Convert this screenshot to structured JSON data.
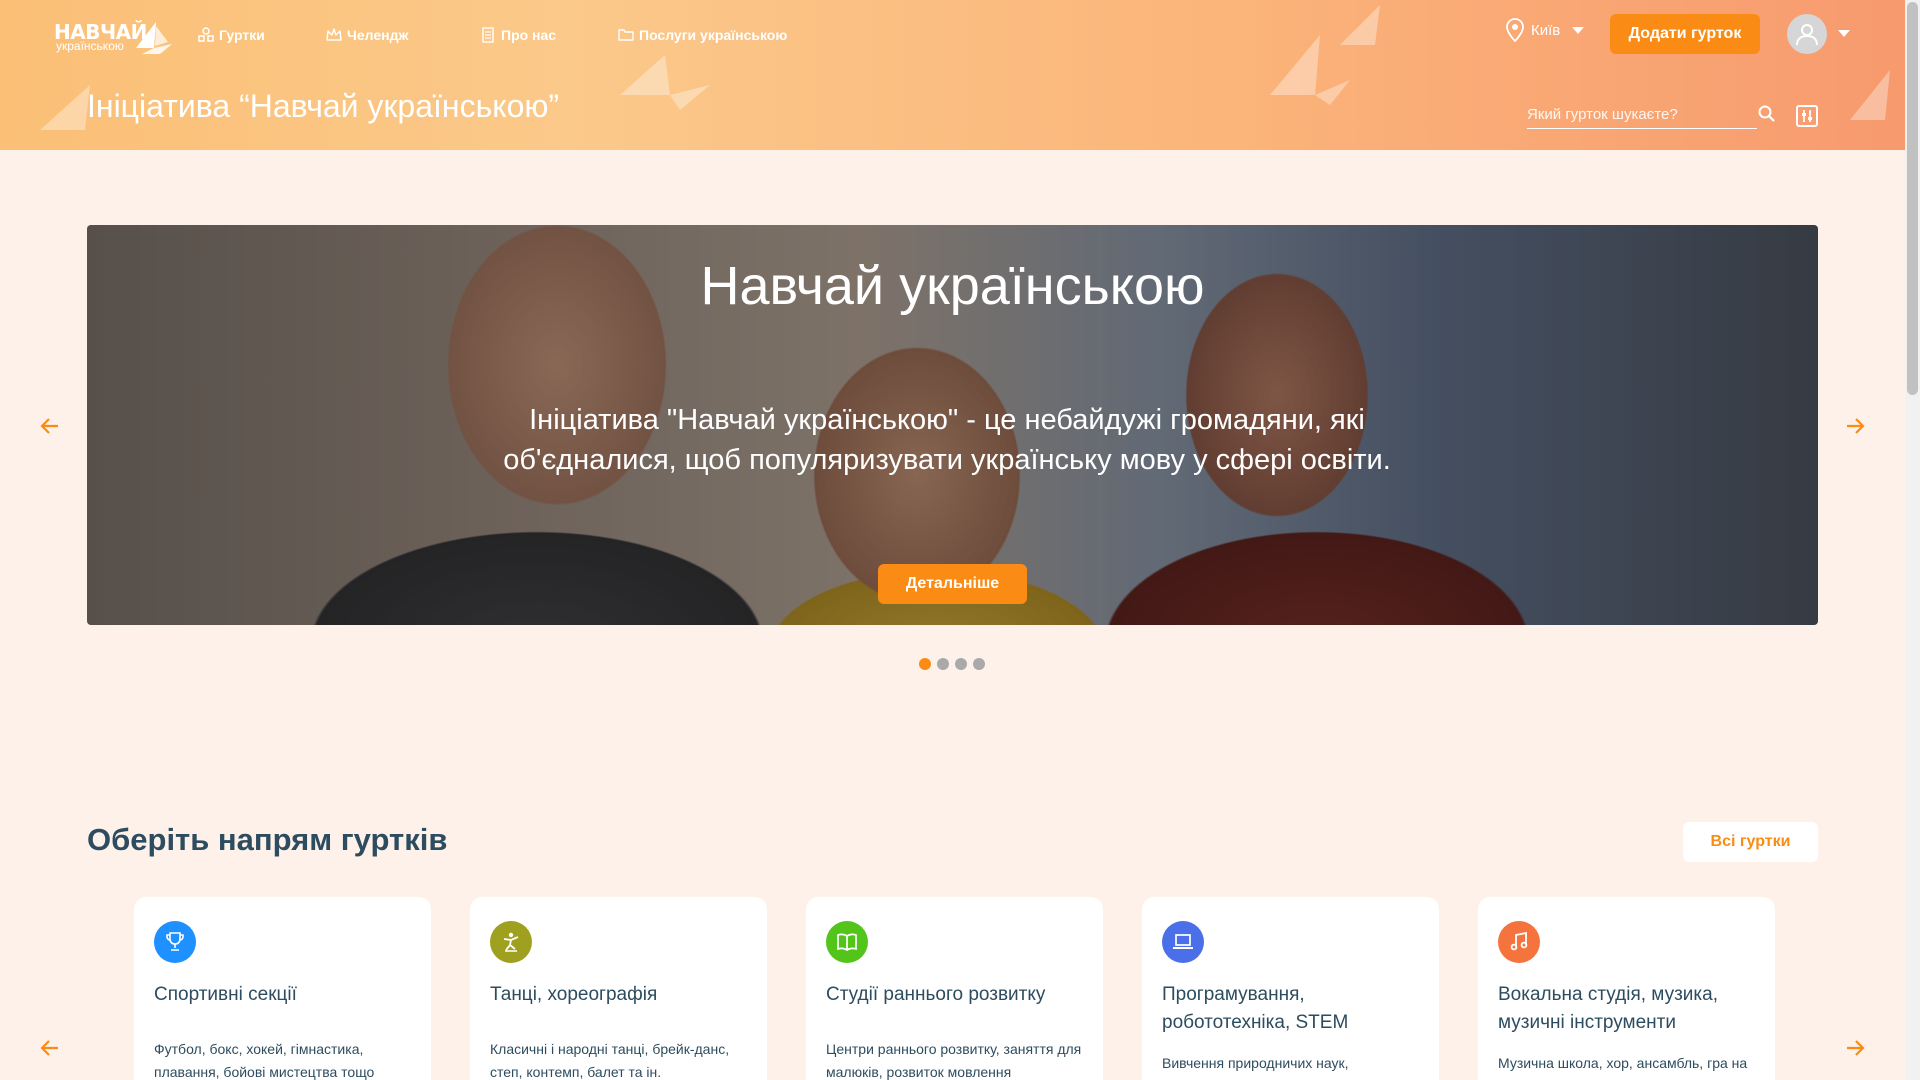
{
  "header": {
    "logo_main": "НАВЧАЙ",
    "logo_sub": "українською",
    "nav": [
      {
        "label": "Гуртки",
        "icon": "clubs-icon"
      },
      {
        "label": "Челендж",
        "icon": "crown-icon"
      },
      {
        "label": "Про нас",
        "icon": "document-icon"
      },
      {
        "label": "Послуги українською",
        "icon": "folder-icon"
      }
    ],
    "city": "Київ",
    "add_club_label": "Додати гурток",
    "page_title": "Ініціатива “Навчай українською”",
    "search_placeholder": "Який гурток шукаєте?"
  },
  "hero": {
    "title": "Навчай українською",
    "text": "Ініціатива \"Навчай українською\" - це небайдужі громадяни, які об'єдналися, щоб популяризувати українську мову у сфері освіти.",
    "button_label": "Детальніше",
    "slides_count": 4,
    "active_slide": 1
  },
  "categories": {
    "title": "Оберіть напрям гуртків",
    "all_label": "Всі гуртки",
    "items": [
      {
        "title": "Спортивні секції",
        "desc": "Футбол, бокс, хокей, гімнастика, плавання, бойові мистецтва тощо",
        "icon": "trophy-icon",
        "color": "#1e90ff"
      },
      {
        "title": "Танці, хореографія",
        "desc": "Класичні і народні танці, брейк-данс, степ, контемп, балет та ін.",
        "icon": "dancer-icon",
        "color": "#a0a020"
      },
      {
        "title": "Студії раннього розвитку",
        "desc": "Центри раннього розвитку, заняття для малюків, розвиток мовлення",
        "icon": "book-icon",
        "color": "#52c41a"
      },
      {
        "title": "Програмування, робототехніка, STEM",
        "desc": "Вивчення природничих наук,",
        "icon": "laptop-icon",
        "color": "#4a6fe8"
      },
      {
        "title": "Вокальна студія, музика, музичні інструменти",
        "desc": "Музична школа, хор, ансамбль, гра на",
        "icon": "music-icon",
        "color": "#f5733d"
      }
    ]
  },
  "colors": {
    "accent": "#fa8c16",
    "text": "#2d4c5f",
    "background": "#fdf1ea"
  }
}
